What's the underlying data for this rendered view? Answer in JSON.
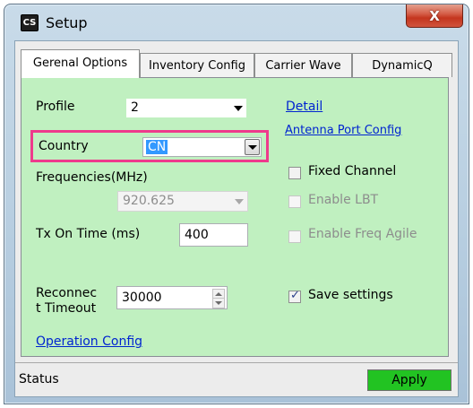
{
  "window": {
    "title": "Setup",
    "icon_text": "CS",
    "close_glyph": "X",
    "icon_name": "app-icon"
  },
  "tabs": [
    {
      "label": "Gerenal Options",
      "active": true
    },
    {
      "label": "Inventory Config",
      "active": false
    },
    {
      "label": "Carrier Wave",
      "active": false
    },
    {
      "label": "DynamicQ",
      "active": false
    }
  ],
  "general": {
    "profile_label": "Profile",
    "profile_value": "2",
    "detail_link": "Detail",
    "antenna_link": "Antenna Port Config",
    "country_label": "Country",
    "country_value": "CN",
    "frequencies_label": "Frequencies(MHz)",
    "frequency_value": "920.625",
    "fixed_channel_label": "Fixed Channel",
    "fixed_channel_checked": false,
    "enable_lbt_label": "Enable LBT",
    "enable_lbt_checked": false,
    "tx_on_time_label": "Tx On Time (ms)",
    "tx_on_time_value": "400",
    "enable_freq_agile_label": "Enable Freq Agile",
    "enable_freq_agile_checked": false,
    "reconnect_label_line1": "Reconnec",
    "reconnect_label_line2": "t Timeout",
    "reconnect_value": "30000",
    "save_settings_label": "Save settings",
    "save_settings_checked": true,
    "operation_link": "Operation Config"
  },
  "status": {
    "text": "Status",
    "apply_label": "Apply",
    "apply_color": "#22c322"
  },
  "highlight_color": "#ee3a8c",
  "panel_color": "#c0f0c0"
}
